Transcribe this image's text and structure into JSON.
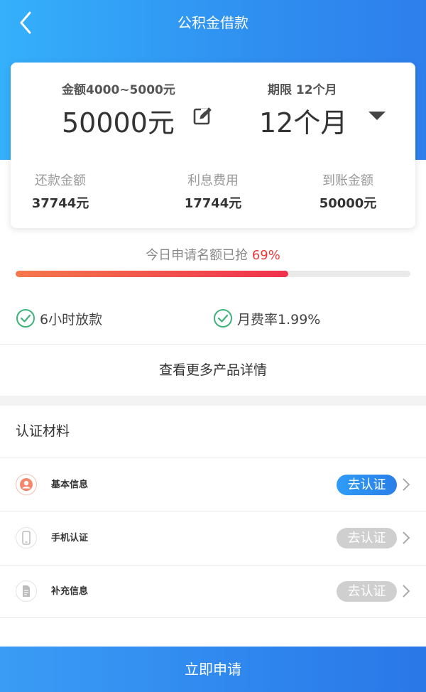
{
  "nav": {
    "title": "公积金借款"
  },
  "loan": {
    "amount_label": "金额4000~5000元",
    "amount_value": "50000元",
    "term_label": "期限 12个月",
    "term_value": "12个月"
  },
  "stats": [
    {
      "label": "还款金额",
      "value": "37744元"
    },
    {
      "label": "利息费用",
      "value": "17744元"
    },
    {
      "label": "到账金额",
      "value": "50000元"
    }
  ],
  "quota": {
    "text": "今日申请名额已抢",
    "percent_text": "69%",
    "progress": 0.69
  },
  "features": [
    {
      "label": "6小时放款"
    },
    {
      "label": "月费率1.99%"
    }
  ],
  "more_link": "查看更多产品详情",
  "certification": {
    "title": "认证材料",
    "items": [
      {
        "name": "基本信息",
        "action": "去认证",
        "icon": "user-icon",
        "enabled": true
      },
      {
        "name": "手机认证",
        "action": "去认证",
        "icon": "phone-icon",
        "enabled": false
      },
      {
        "name": "补充信息",
        "action": "去认证",
        "icon": "document-icon",
        "enabled": false
      }
    ]
  },
  "submit_label": "立即申请",
  "colors": {
    "brand_blue": "#2f8ff0",
    "accent_red": "#ee3a3a",
    "check_green": "#3fb27a"
  }
}
